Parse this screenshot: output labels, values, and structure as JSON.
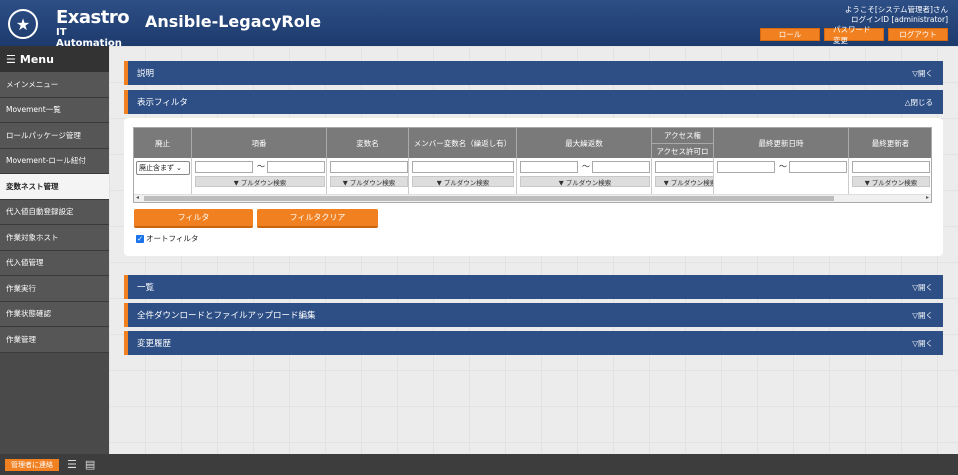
{
  "header": {
    "logo_name": "Exastro",
    "logo_sub": "IT Automation",
    "app_title": "Ansible-LegacyRole",
    "welcome": "ようこそ[システム管理者]さん",
    "login_id": "ログインID [administrator]",
    "buttons": [
      "ロール",
      "パスワード変更",
      "ログアウト"
    ]
  },
  "sidebar": {
    "title": "Menu",
    "items": [
      "メインメニュー",
      "Movement一覧",
      "ロールパッケージ管理",
      "Movement-ロール紐付",
      "変数ネスト管理",
      "代入値自動登録設定",
      "作業対象ホスト",
      "代入値管理",
      "作業実行",
      "作業状態確認",
      "作業管理"
    ],
    "active_index": 4
  },
  "sections": {
    "description": {
      "label": "説明",
      "toggle": "▽開く"
    },
    "display_filter": {
      "label": "表示フィルタ",
      "toggle": "△閉じる"
    },
    "list": {
      "label": "一覧",
      "toggle": "▽開く"
    },
    "bulk": {
      "label": "全件ダウンロードとファイルアップロード編集",
      "toggle": "▽開く"
    },
    "history": {
      "label": "変更履歴",
      "toggle": "▽開く"
    }
  },
  "filter_table": {
    "columns": [
      "廃止",
      "項番",
      "変数名",
      "メンバー変数名（繰返し有）",
      "最大繰返数",
      "アクセス権",
      "アクセス許可ロ",
      "最終更新日時",
      "最終更新者"
    ],
    "select_value": "廃止含まず",
    "pulldown_label": "▼ プルダウン検索",
    "tilde": "〜"
  },
  "filter_buttons": {
    "filter": "フィルタ",
    "clear": "フィルタクリア"
  },
  "auto_filter": "オートフィルタ",
  "footer": {
    "contact": "管理者に連絡"
  }
}
